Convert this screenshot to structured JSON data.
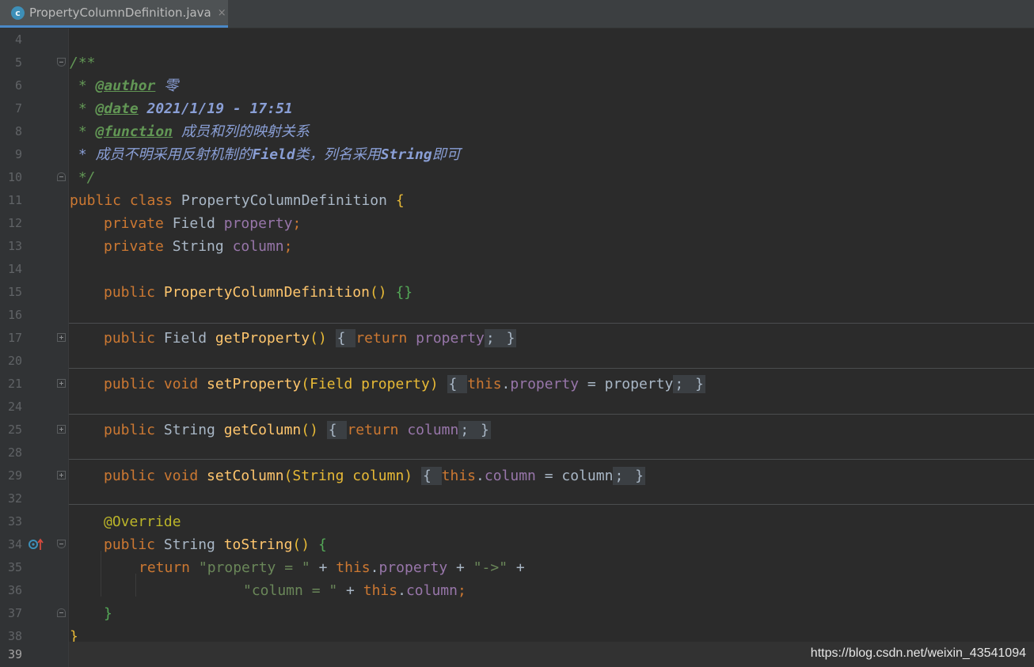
{
  "tab": {
    "icon_letter": "c",
    "filename": "PropertyColumnDefinition.java",
    "close": "×"
  },
  "lines": [
    {
      "n": "4"
    },
    {
      "n": "5"
    },
    {
      "n": "6"
    },
    {
      "n": "7"
    },
    {
      "n": "8"
    },
    {
      "n": "9"
    },
    {
      "n": "10"
    },
    {
      "n": "11"
    },
    {
      "n": "12"
    },
    {
      "n": "13"
    },
    {
      "n": "14"
    },
    {
      "n": "15"
    },
    {
      "n": "16"
    },
    {
      "n": "17"
    },
    {
      "n": "20"
    },
    {
      "n": "21"
    },
    {
      "n": "24"
    },
    {
      "n": "25"
    },
    {
      "n": "28"
    },
    {
      "n": "29"
    },
    {
      "n": "32"
    },
    {
      "n": "33"
    },
    {
      "n": "34"
    },
    {
      "n": "35"
    },
    {
      "n": "36"
    },
    {
      "n": "37"
    },
    {
      "n": "38"
    },
    {
      "n": "39"
    }
  ],
  "code": {
    "l5": "/**",
    "l6_star": " * ",
    "l6_tag": "@author",
    "l6_val": " 零",
    "l7_star": " * ",
    "l7_tag": "@date",
    "l7_val": " 2021/1/19 - 17:51",
    "l8_star": " * ",
    "l8_tag": "@function",
    "l8_val": " 成员和列的映射关系",
    "l9_a": " * 成员不明采用反射机制的",
    "l9_b": "Field",
    "l9_c": "类，列名采用",
    "l9_d": "String",
    "l9_e": "即可",
    "l10": " */",
    "l11_kw": "public class ",
    "l11_cls": "PropertyColumnDefinition ",
    "l11_brace": "{",
    "l12_kw": "private ",
    "l12_type": "Field ",
    "l12_fld": "property",
    "l12_semi": ";",
    "l13_kw": "private ",
    "l13_type": "String ",
    "l13_fld": "column",
    "l13_semi": ";",
    "l15_kw": "public ",
    "l15_fn": "PropertyColumnDefinition",
    "l15_paren": "() ",
    "l15_body": "{}",
    "l17_kw": "public ",
    "l17_type": "Field ",
    "l17_fn": "getProperty",
    "l17_paren": "() ",
    "l17_ob": "{ ",
    "l17_ret": "return ",
    "l17_fld": "property",
    "l17_semi": "; ",
    "l17_cb": "}",
    "l21_kw": "public void ",
    "l21_fn": "setProperty",
    "l21_params": "(Field property) ",
    "l21_ob": "{ ",
    "l21_this": "this",
    "l21_dot": ".",
    "l21_fld": "property",
    "l21_rest": " = property",
    "l21_semi": "; ",
    "l21_cb": "}",
    "l25_kw": "public ",
    "l25_type": "String ",
    "l25_fn": "getColumn",
    "l25_paren": "() ",
    "l25_ob": "{ ",
    "l25_ret": "return ",
    "l25_fld": "column",
    "l25_semi": "; ",
    "l25_cb": "}",
    "l29_kw": "public void ",
    "l29_fn": "setColumn",
    "l29_params": "(String column) ",
    "l29_ob": "{ ",
    "l29_this": "this",
    "l29_dot": ".",
    "l29_fld": "column",
    "l29_rest": " = column",
    "l29_semi": "; ",
    "l29_cb": "}",
    "l33": "@Override",
    "l34_kw": "public ",
    "l34_type": "String ",
    "l34_fn": "toString",
    "l34_paren": "() ",
    "l34_brace": "{",
    "l35_ret": "return ",
    "l35_s1": "\"property = \"",
    "l35_plus1": " + ",
    "l35_this": "this",
    "l35_dot": ".",
    "l35_fld": "property",
    "l35_plus2": " + ",
    "l35_s2": "\"->\"",
    "l35_plus3": " +",
    "l36_s": "\"column = \"",
    "l36_plus": " + ",
    "l36_this": "this",
    "l36_dot": ".",
    "l36_fld": "column",
    "l36_semi": ";",
    "l37": "}",
    "l38": "}"
  },
  "watermark": "https://blog.csdn.net/weixin_43541094",
  "colors": {
    "background": "#2b2b2b",
    "gutter": "#313335",
    "keyword": "#cc7832",
    "field": "#9876aa",
    "method": "#ffc66d",
    "string": "#6a8759",
    "doc": "#629755",
    "annotation": "#bbb529",
    "tab_accent": "#4a88c7"
  }
}
